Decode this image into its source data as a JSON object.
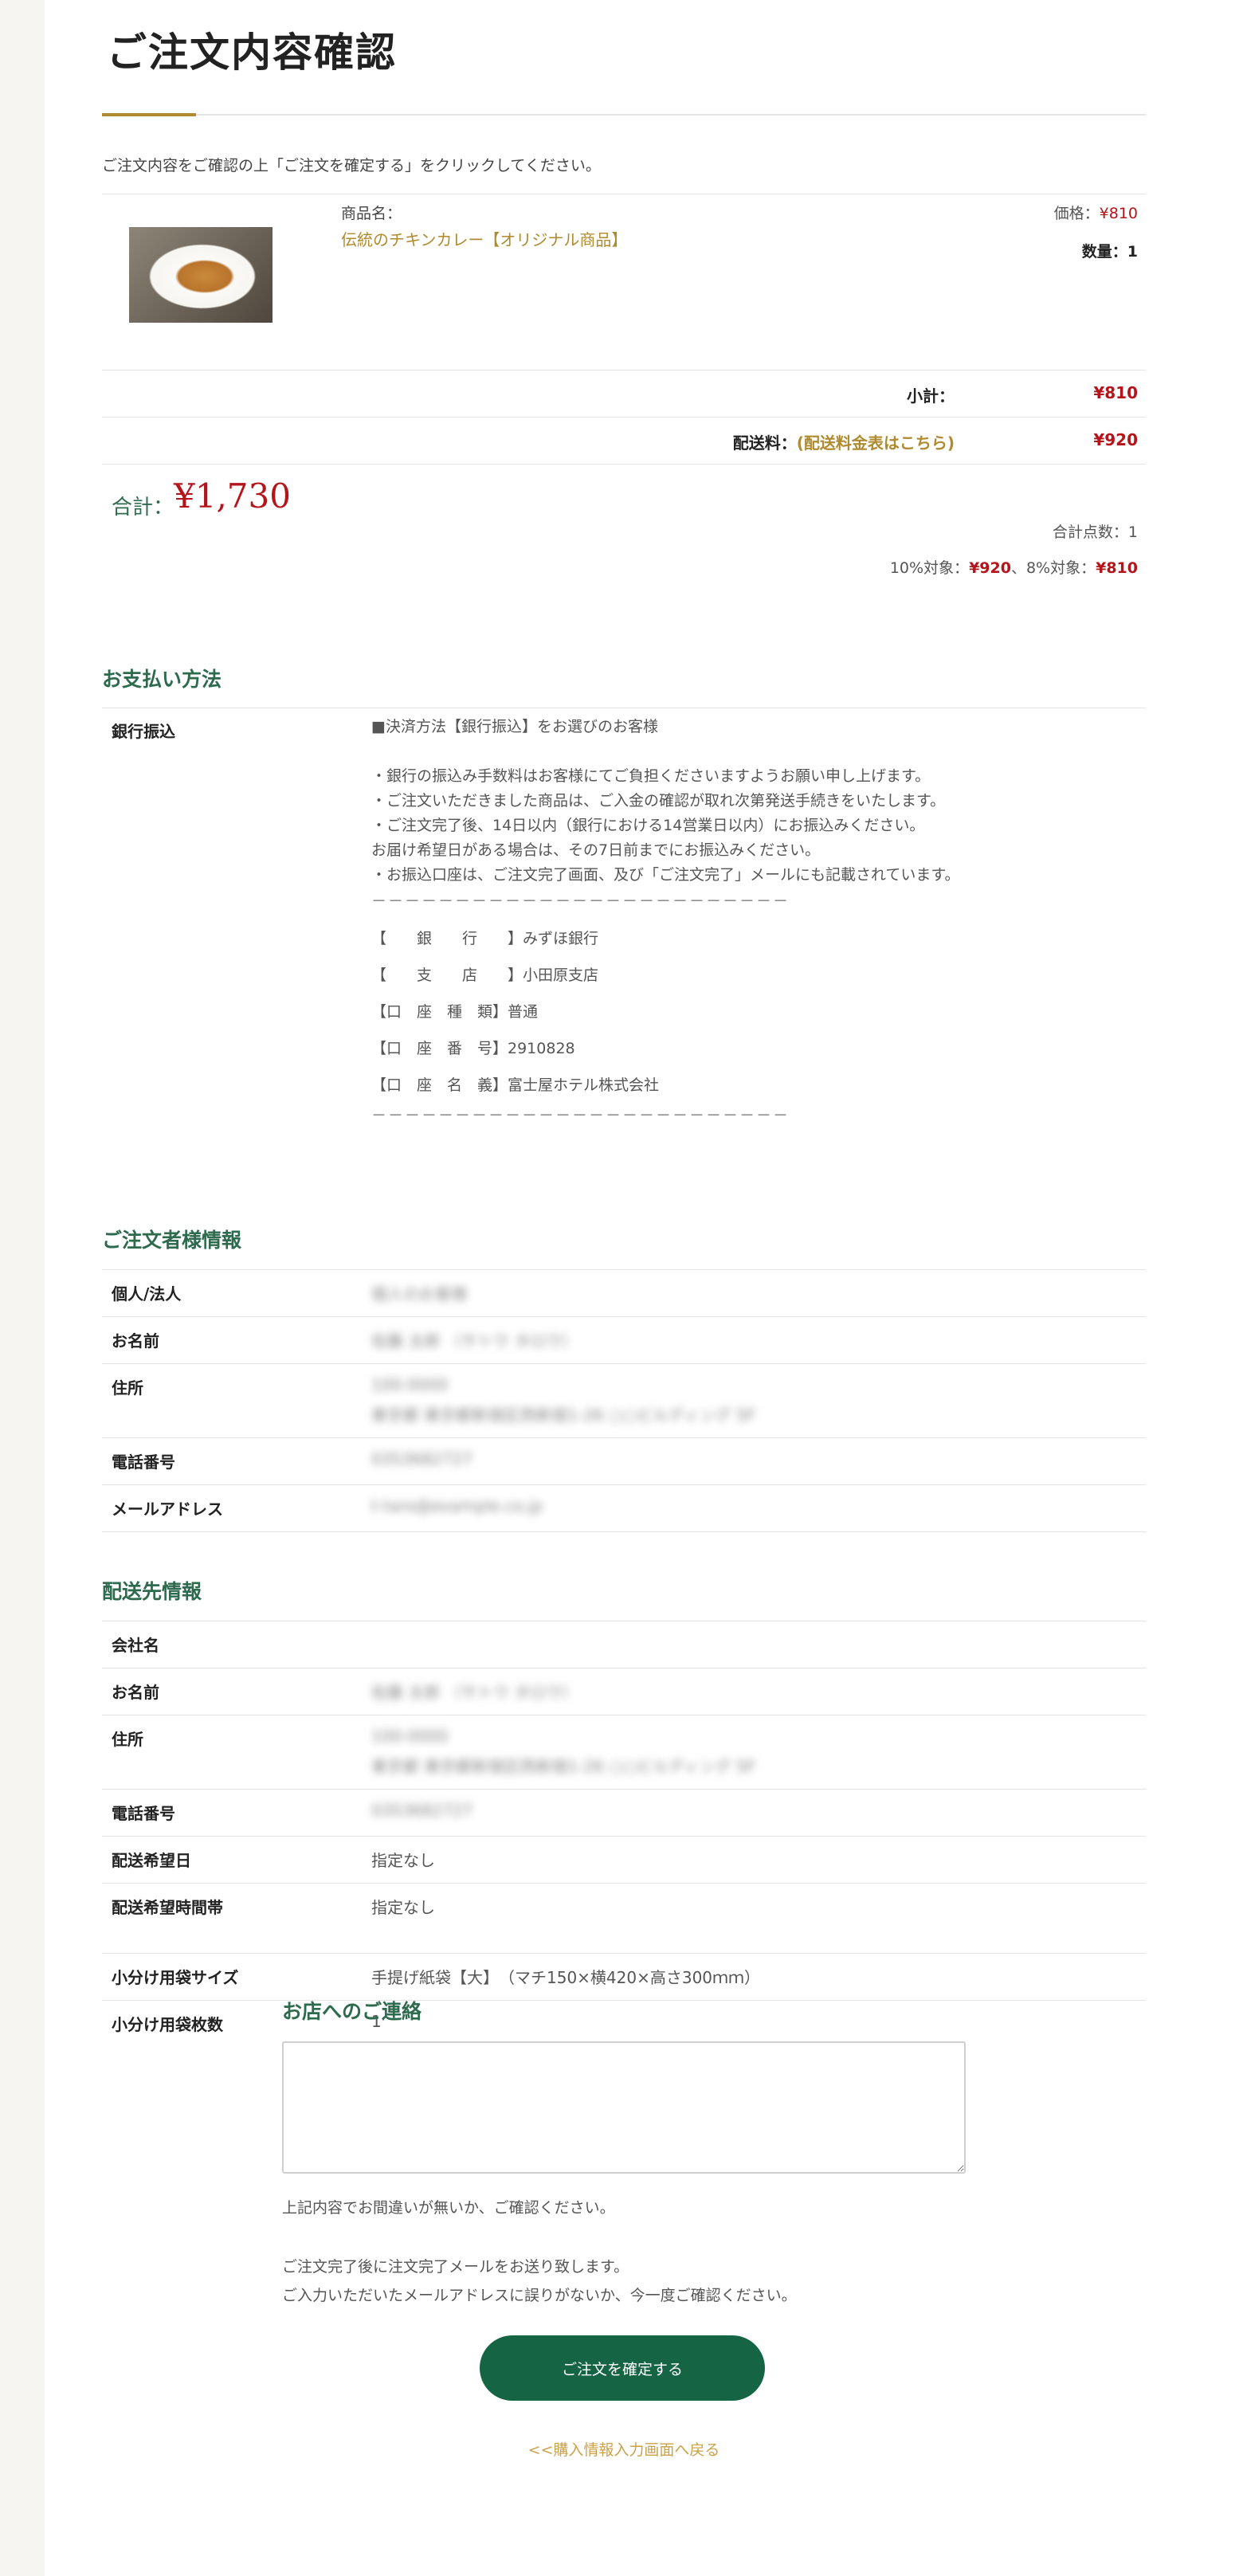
{
  "page_title": "ご注文内容確認",
  "intro": "ご注文内容をご確認の上「ご注文を確定する」をクリックしてください。",
  "product": {
    "label": "商品名：",
    "name": "伝統のチキンカレー【オリジナル商品】",
    "price_label": "価格：",
    "price": "¥810",
    "qty_label": "数量：1"
  },
  "summary": {
    "subtotal_label": "小計：",
    "subtotal": "¥810",
    "shipping_label": "配送料：",
    "shipping_link": "(配送料金表はこちら)",
    "shipping": "¥920",
    "total_label": "合計：",
    "total": "¥1,730",
    "count": "合計点数：1",
    "tax10_label": "10%対象：",
    "tax10": "¥920",
    "tax_sep": "、8%対象：",
    "tax8": "¥810"
  },
  "payment": {
    "heading": "お支払い方法",
    "method": "銀行振込",
    "lines": [
      "■決済方法【銀行振込】をお選びのお客様",
      "",
      "・銀行の振込み手数料はお客様にてご負担くださいますようお願い申し上げます。",
      "・ご注文いただきました商品は、ご入金の確認が取れ次第発送手続きをいたします。",
      "・ご注文完了後、14日以内（銀行における14営業日以内）にお振込みください。",
      "お届け希望日がある場合は、その7日前までにお振込みください。",
      "・お振込口座は、ご注文完了画面、及び「ご注文完了」メールにも記載されています。"
    ],
    "dash": "－－－－－－－－－－－－－－－－－－－－－－－－－",
    "bank": [
      "【　　銀　　行　　】みずほ銀行",
      "【　　支　　店　　】小田原支店",
      "【口　座　種　類】普通",
      "【口　座　番　号】2910828",
      "【口　座　名　義】富士屋ホテル株式会社"
    ]
  },
  "customer": {
    "heading": "ご注文者様情報",
    "rows": [
      {
        "label": "個人/法人",
        "value": "個人のお客様"
      },
      {
        "label": "お名前",
        "value": "佐藤 太郎 （サトウ タロウ）"
      },
      {
        "label": "住所",
        "value": "100-0000",
        "value2": "東京都 東京都新宿区西新宿1-26 ○○ビルディング 5F"
      },
      {
        "label": "電話番号",
        "value": "0353682727"
      },
      {
        "label": "メールアドレス",
        "value": "t-taro@example.co.jp"
      }
    ]
  },
  "delivery": {
    "heading": "配送先情報",
    "rows": [
      {
        "label": "会社名",
        "value": ""
      },
      {
        "label": "お名前",
        "value": "佐藤 太郎 （サトウ タロウ）"
      },
      {
        "label": "住所",
        "value": "100-0000",
        "value2": "東京都 東京都新宿区西新宿1-26 ○○ビルディング 5F"
      },
      {
        "label": "電話番号",
        "value": "0353682727"
      },
      {
        "label": "配送希望日",
        "value": "指定なし"
      },
      {
        "label": "配送希望時間帯",
        "value": "指定なし"
      }
    ]
  },
  "bag": {
    "rows": [
      {
        "label": "小分け用袋サイズ",
        "value": "手提げ紙袋【大】　（マチ150×横420×高さ300ｍｍ）"
      },
      {
        "label": "小分け用袋枚数",
        "value": "1"
      }
    ]
  },
  "contact": {
    "heading": "お店へのご連絡",
    "textarea_value": ""
  },
  "notes": {
    "n1": "上記内容でお間違いが無いか、ご確認ください。",
    "n2": "ご注文完了後に注文完了メールをお送り致します。",
    "n3": "ご入力いただいたメールアドレスに誤りがないか、今一度ご確認ください。"
  },
  "confirm_button": "ご注文を確定する",
  "back_link": "<<購入情報入力画面へ戻る",
  "colors": {
    "accent_green": "#156444",
    "gold": "#b08a2e",
    "price_red": "#b4141a"
  }
}
